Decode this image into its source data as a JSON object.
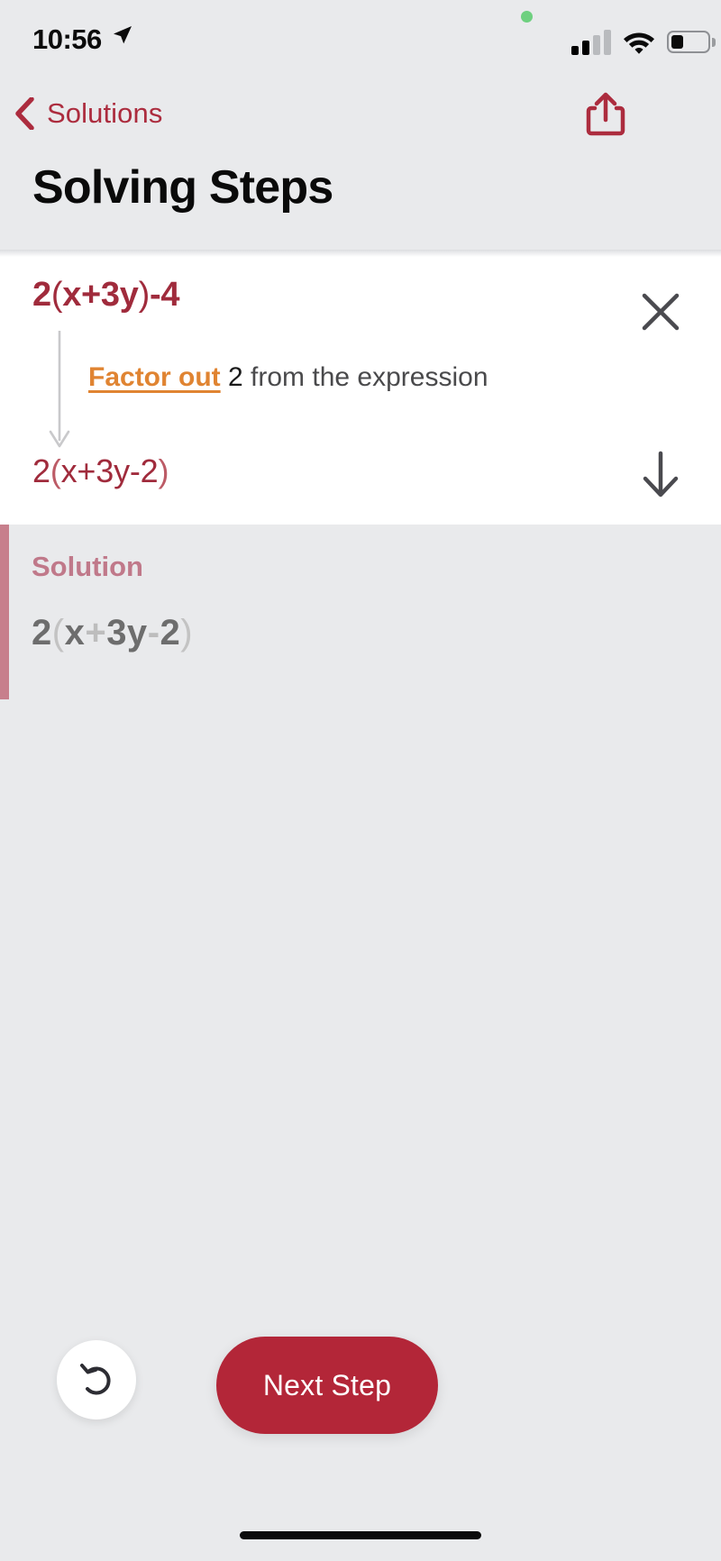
{
  "status_bar": {
    "time": "10:56",
    "location_icon": "location-arrow-icon",
    "recording_icon": "green-recording-dot",
    "signal_icon": "cellular-signal-icon",
    "signal_bars_filled": 2,
    "signal_bars_total": 4,
    "wifi_icon": "wifi-icon",
    "battery_icon": "battery-icon",
    "battery_level_percent": 30
  },
  "nav_bar": {
    "back_label": "Solutions",
    "back_icon": "chevron-left-icon",
    "share_icon": "share-upload-icon"
  },
  "header": {
    "title": "Solving Steps"
  },
  "step_card": {
    "expression_before": "2(x+3y)-4",
    "expression_before_parts": {
      "lead": "2",
      "open_paren": "(",
      "inner": "x+3y",
      "close_paren": ")",
      "tail": "-4"
    },
    "close_icon": "close-x-icon",
    "flow_arrow_icon": "down-arrow-connector-icon",
    "hint": {
      "link_text": "Factor out",
      "number": "2",
      "rest_text": "from the expression"
    },
    "expression_after": "2(x+3y-2)",
    "expression_after_parts": {
      "lead": "2",
      "open_paren": "(",
      "inner": "x+3y-2",
      "close_paren": ")"
    },
    "next_icon": "arrow-down-icon"
  },
  "solution": {
    "label": "Solution",
    "expression": "2(x+3y-2)",
    "expression_parts": {
      "lead": "2",
      "open_paren": "(",
      "term_x": "x",
      "plus": "+",
      "term_3y": "3y",
      "minus": "-",
      "term_2": "2",
      "close_paren": ")"
    }
  },
  "actions": {
    "undo_icon": "undo-arrow-icon",
    "next_step_label": "Next Step"
  },
  "home_indicator": "home-indicator-bar",
  "colors": {
    "background": "#e9eaec",
    "card": "#ffffff",
    "brand_red": "#ac2c3e",
    "expression_red": "#a02b3c",
    "button_red": "#b32638",
    "link_orange": "#e08432",
    "solution_pink": "#c0798a",
    "solution_bar": "#c77f8c",
    "solution_gray": "#6d6d6d"
  }
}
